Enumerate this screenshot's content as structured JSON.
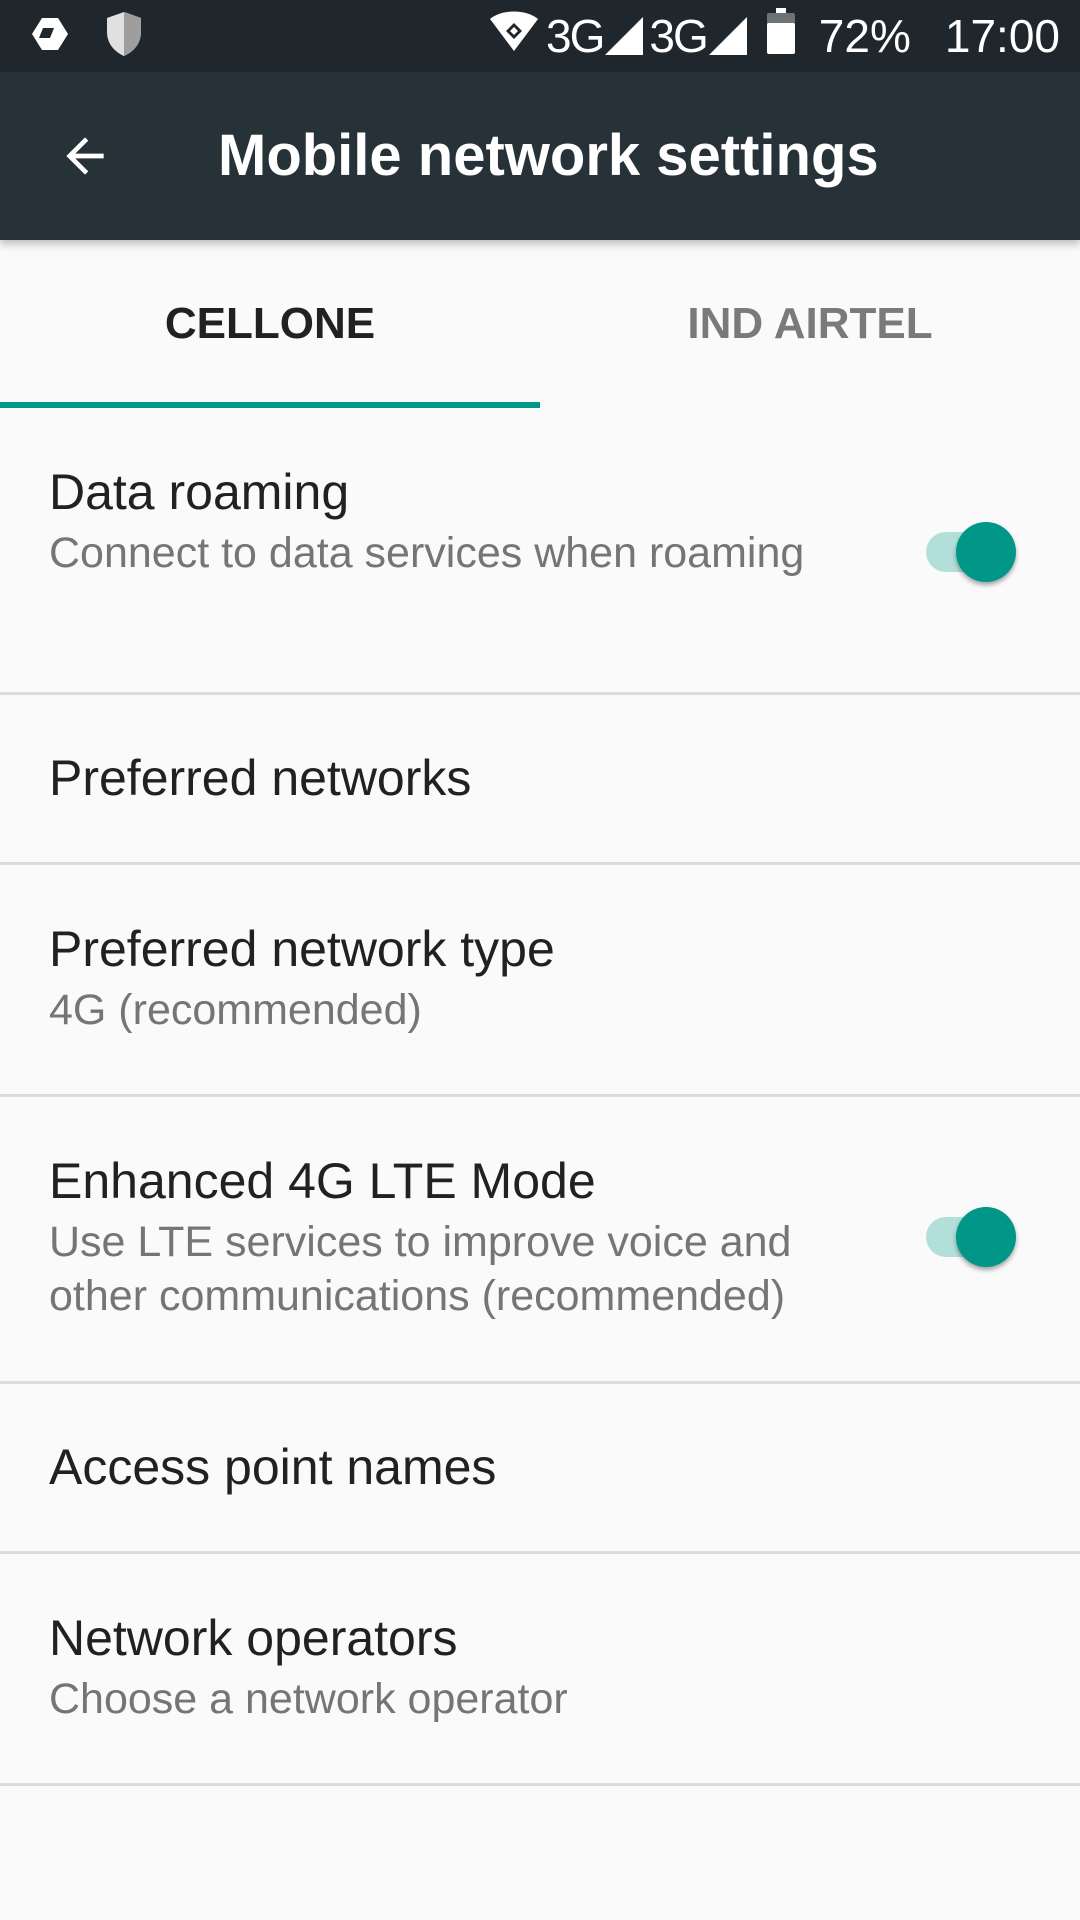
{
  "status_bar": {
    "network1": "3G",
    "network2": "3G",
    "battery": "72%",
    "time": "17:00"
  },
  "app_bar": {
    "title": "Mobile network settings"
  },
  "tabs": [
    {
      "label": "CELLONE",
      "active": true
    },
    {
      "label": "IND AIRTEL",
      "active": false
    }
  ],
  "settings": {
    "data_roaming": {
      "title": "Data roaming",
      "summary": "Connect to data services when roaming",
      "enabled": true
    },
    "preferred_networks": {
      "title": "Preferred networks"
    },
    "preferred_network_type": {
      "title": "Preferred network type",
      "summary": "4G (recommended)"
    },
    "enhanced_lte": {
      "title": "Enhanced 4G LTE Mode",
      "summary": "Use LTE services to improve voice and other communications (recommended)",
      "enabled": true
    },
    "access_point_names": {
      "title": "Access point names"
    },
    "network_operators": {
      "title": "Network operators",
      "summary": "Choose a network operator"
    }
  },
  "colors": {
    "accent": "#009688",
    "app_bar": "#263238",
    "status_bar": "#1f272c"
  }
}
